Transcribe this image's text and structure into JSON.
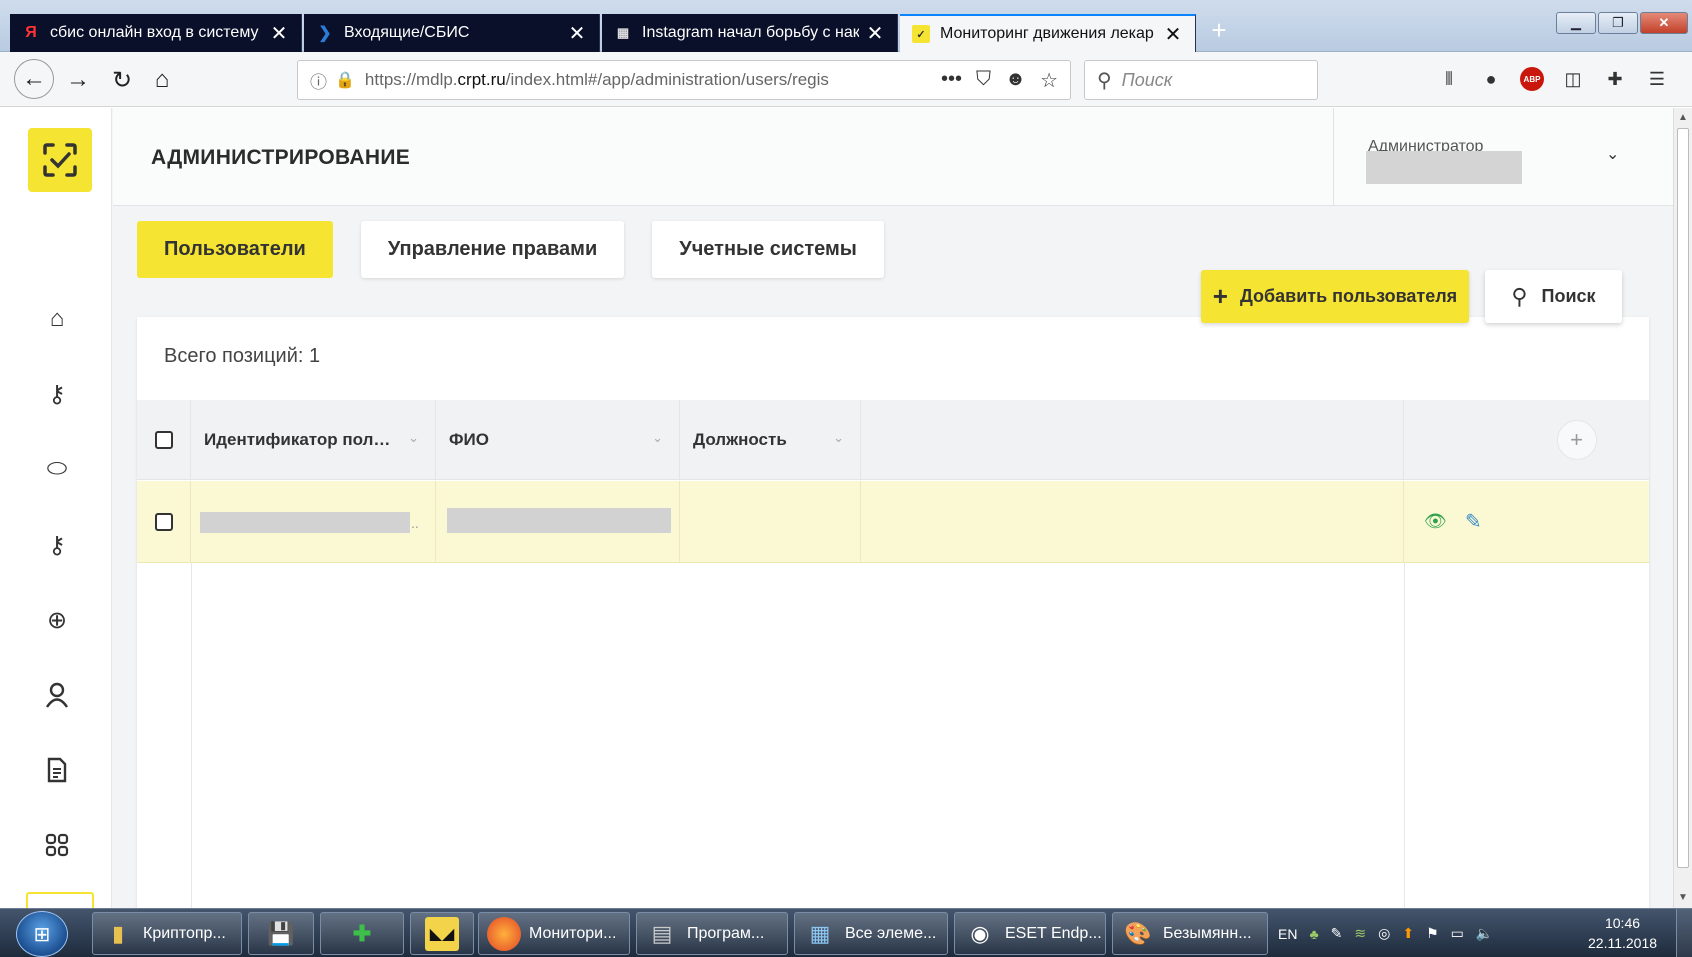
{
  "browser": {
    "tabs": [
      {
        "title": "сбис онлайн вход в систему –",
        "icon": "yandex-icon",
        "glyph": "Я"
      },
      {
        "title": "Входящие/СБИС",
        "icon": "sbis-icon",
        "glyph": "❯"
      },
      {
        "title": "Instagram начал борьбу с нак",
        "icon": "news-icon",
        "glyph": "▦"
      },
      {
        "title": "Мониторинг движения лекар",
        "icon": "mdlp-icon",
        "glyph": "✓",
        "active": true
      }
    ],
    "url_prefix": "https://mdlp.",
    "url_domain": "crpt.ru",
    "url_suffix": "/index.html#/app/administration/users/regis",
    "search_placeholder": "Поиск",
    "more_icon": "•••"
  },
  "app": {
    "page_title": "АДМИНИСТРИРОВАНИЕ",
    "user_role": "Администратор",
    "tabs": [
      {
        "label": "Пользователи",
        "active": true
      },
      {
        "label": "Управление правами",
        "active": false
      },
      {
        "label": "Учетные системы",
        "active": false
      }
    ],
    "add_user_label": "Добавить пользователя",
    "search_label": "Поиск",
    "total_label": "Всего позиций: 1",
    "columns": [
      {
        "label": "Идентификатор польз..."
      },
      {
        "label": "ФИО"
      },
      {
        "label": "Должность"
      }
    ],
    "row_ellipsis": "..",
    "accent_color": "#f6e432",
    "row_highlight_color": "#fbf9d3"
  },
  "taskbar": {
    "items": [
      {
        "label": "Криптопр...",
        "icon": "folder-icon"
      },
      {
        "label": "",
        "icon": "floppy-icon"
      },
      {
        "label": "",
        "icon": "pharmacy-icon"
      },
      {
        "label": "",
        "icon": "bat-icon"
      },
      {
        "label": "Монитори...",
        "icon": "firefox-icon"
      },
      {
        "label": "Програм...",
        "icon": "programs-icon"
      },
      {
        "label": "Все элеме...",
        "icon": "control-panel-icon"
      },
      {
        "label": "ESET Endp...",
        "icon": "eset-icon"
      },
      {
        "label": "Безымянн...",
        "icon": "paint-icon"
      }
    ],
    "lang": "EN",
    "time": "10:46",
    "date": "22.11.2018"
  }
}
